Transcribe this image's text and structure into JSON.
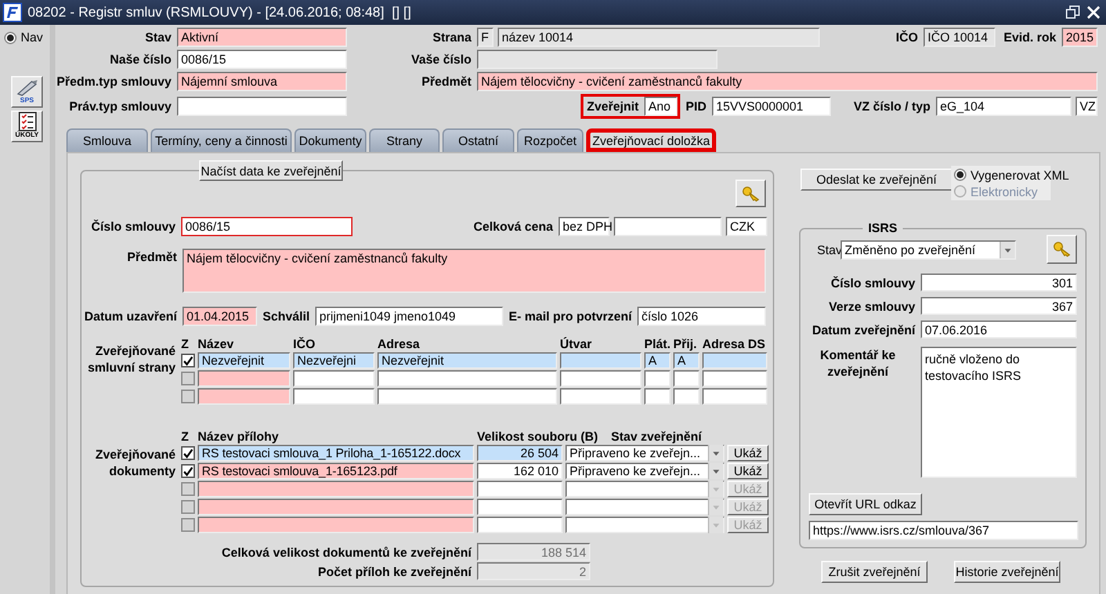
{
  "window": {
    "title": "08202 - Registr smluv (RSMLOUVY) - [24.06.2016; 08:48]  [] []"
  },
  "sidebar": {
    "nav": {
      "label": "Nav",
      "selected": true
    },
    "buttons": [
      "SPS",
      "ÚKOLY"
    ]
  },
  "header": [
    [
      {
        "label": "Stav",
        "fields": [
          {
            "value": "Aktivní",
            "kind": "required"
          }
        ]
      },
      {
        "label": "Strana",
        "fields": [
          {
            "value": "F",
            "kind": "readonly"
          },
          {
            "value": "název 10014",
            "kind": "readonly"
          }
        ]
      },
      {
        "label": "IČO",
        "fields": [
          {
            "value": "IČO 10014",
            "kind": "readonly"
          }
        ]
      },
      {
        "label": "Evid. rok",
        "fields": [
          {
            "value": "2015",
            "kind": "required"
          }
        ]
      }
    ],
    [
      {
        "label": "Naše číslo",
        "fields": [
          {
            "value": "0086/15",
            "kind": "optional"
          }
        ]
      },
      {
        "label": "Vaše číslo",
        "fields": [
          {
            "kind": "readonly"
          }
        ]
      }
    ],
    [
      {
        "label": "Předm.typ smlouvy",
        "fields": [
          {
            "value": "Nájemní smlouva",
            "kind": "required"
          }
        ]
      },
      {
        "label": "Předmět",
        "fields": [
          {
            "value": "Nájem tělocvičny - cvičení zaměstnanců fakulty",
            "kind": "required"
          }
        ]
      }
    ],
    [
      {
        "label": "Práv.typ smlouvy",
        "highlighted": false,
        "fields": [
          {
            "kind": "optional"
          }
        ]
      },
      {
        "label": "Zveřejnit",
        "highlighted": true,
        "fields": [
          {
            "value": "Ano",
            "kind": "optional"
          }
        ]
      },
      {
        "label": "PID",
        "highlighted": false,
        "fields": [
          {
            "value": "15VVS0000001",
            "kind": "optional"
          }
        ]
      },
      {
        "label": "VZ číslo / typ",
        "highlighted": false,
        "fields": [
          {
            "value": "eG_104",
            "kind": "optional"
          },
          {
            "value": "VZ",
            "kind": "optional"
          }
        ]
      }
    ]
  ],
  "tabs": [
    {
      "label": "Smlouva",
      "selected": false,
      "highlighted": false
    },
    {
      "label": "Termíny, ceny a činnosti",
      "selected": false,
      "highlighted": false
    },
    {
      "label": "Dokumenty",
      "selected": false,
      "highlighted": false
    },
    {
      "label": "Strany",
      "selected": false,
      "highlighted": false
    },
    {
      "label": "Ostatní",
      "selected": false,
      "highlighted": false
    },
    {
      "label": "Rozpočet",
      "selected": false,
      "highlighted": false
    },
    {
      "label": "Zveřejňovací doložka",
      "selected": true,
      "highlighted": true
    }
  ],
  "publication": {
    "load_button": "Načíst data ke zveřejnění",
    "details": [
      [
        {
          "label": "Číslo smlouvy",
          "fields": [
            {
              "value": "0086/15",
              "kind": "invalid"
            }
          ]
        },
        {
          "label": "Celková cena",
          "fields": [
            {
              "value": "bez DPH",
              "kind": "optional"
            },
            {
              "kind": "optional"
            },
            {
              "value": "CZK",
              "kind": "optional"
            }
          ]
        }
      ],
      [
        {
          "label": "Předmět",
          "fields": [
            {
              "value": "Nájem tělocvičny - cvičení zaměstnanců fakulty",
              "kind": "required"
            }
          ]
        }
      ],
      [
        {
          "label": "Datum uzavření",
          "fields": [
            {
              "value": "01.04.2015",
              "kind": "required"
            }
          ]
        },
        {
          "label": "Schválil",
          "fields": [
            {
              "value": "prijmeni1049 jmeno1049",
              "kind": "optional"
            }
          ]
        },
        {
          "label": "E- mail pro potvrzení",
          "fields": [
            {
              "value": "číslo 1026",
              "kind": "optional"
            }
          ]
        }
      ]
    ],
    "parties": {
      "label": "Zveřejňované smluvní strany",
      "check_header": "Z",
      "columns": [
        {
          "label": "Název",
          "required": true
        },
        {
          "label": "IČO",
          "required": false
        },
        {
          "label": "Adresa",
          "required": false
        },
        {
          "label": "Útvar",
          "required": false
        },
        {
          "label": "Plát.",
          "required": false
        },
        {
          "label": "Přij.",
          "required": false
        },
        {
          "label": "Adresa DS",
          "required": false
        }
      ],
      "rows": [
        {
          "checked": true,
          "selected": true,
          "cells": [
            {
              "value": "Nezveřejnit"
            },
            {
              "value": "Nezveřejni"
            },
            {
              "value": "Nezveřejnit"
            },
            {},
            {
              "value": "A"
            },
            {
              "value": "A"
            },
            {}
          ]
        },
        {
          "checked": false,
          "selected": false,
          "cells": [
            {},
            {},
            {},
            {},
            {},
            {},
            {}
          ]
        },
        {
          "checked": false,
          "selected": false,
          "cells": [
            {},
            {},
            {},
            {},
            {},
            {},
            {}
          ]
        }
      ]
    },
    "documents": {
      "label": "Zveřejňované dokumenty",
      "columns": [
        {
          "label": "Z"
        },
        {
          "label": "Název přílohy"
        },
        {
          "label": "Velikost souboru (B)"
        },
        {
          "label": "Stav zveřejnění"
        }
      ],
      "rows": [
        {
          "checked": true,
          "selected": true,
          "disabled": false,
          "name": "RS testovaci smlouva_1 Priloha_1-165122.docx",
          "size": "26 504",
          "status": "Připraveno ke zveřejn...",
          "action": "Ukáž"
        },
        {
          "checked": true,
          "selected": false,
          "disabled": false,
          "name": "RS testovaci smlouva_1-165123.pdf",
          "size": "162 010",
          "status": "Připraveno ke zveřejn...",
          "action": "Ukáž"
        },
        {
          "checked": false,
          "selected": false,
          "disabled": true,
          "action": "Ukáž"
        },
        {
          "checked": false,
          "selected": false,
          "disabled": true,
          "action": "Ukáž"
        },
        {
          "checked": false,
          "selected": false,
          "disabled": true,
          "action": "Ukáž"
        }
      ],
      "totals": [
        {
          "label": "Celková velikost dokumentů ke zveřejnění",
          "value": "188 514"
        },
        {
          "label": "Počet příloh ke zveřejnění",
          "value": "2"
        }
      ]
    }
  },
  "send": {
    "button": "Odeslat ke zveřejnění",
    "options": [
      {
        "label": "Vygenerovat XML",
        "selected": true,
        "disabled": false
      },
      {
        "label": "Elektronicky",
        "selected": false,
        "disabled": true
      }
    ]
  },
  "isrs": {
    "title": "ISRS",
    "status": {
      "label": "Stav",
      "value": "Změněno po zveřejnění"
    },
    "fields": [
      {
        "label": "Číslo smlouvy",
        "value": "301"
      },
      {
        "label": "Verze smlouvy",
        "value": "367"
      },
      {
        "label": "Datum zveřejnění",
        "value": "07.06.2016"
      }
    ],
    "comment": {
      "label": "Komentář ke zveřejnění",
      "value": "ručně vloženo do testovacího ISRS"
    },
    "url_button": "Otevřít URL odkaz",
    "url": "https://www.isrs.cz/smlouva/367"
  },
  "footer_buttons": [
    "Zrušit zveřejnění",
    "Historie zveřejnění"
  ]
}
